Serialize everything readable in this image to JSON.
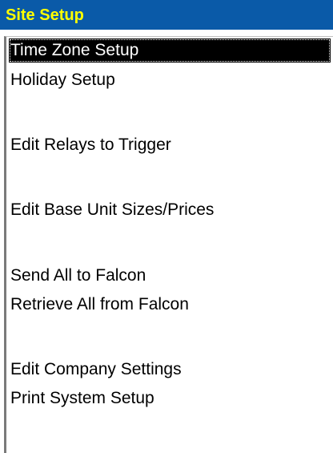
{
  "panel": {
    "title": "Site Setup",
    "colors": {
      "title_background": "#0a5aa8",
      "title_text": "#ffff00",
      "selection_background": "#000000",
      "selection_text": "#ffffff"
    },
    "items": [
      {
        "label": "Time Zone Setup",
        "selected": true
      },
      {
        "label": "Holiday Setup",
        "selected": false
      },
      {
        "label": "Edit Relays to Trigger",
        "selected": false
      },
      {
        "label": "Edit Base Unit Sizes/Prices",
        "selected": false
      },
      {
        "label": "Send All to Falcon",
        "selected": false
      },
      {
        "label": "Retrieve All from Falcon",
        "selected": false
      },
      {
        "label": "Edit Company Settings",
        "selected": false
      },
      {
        "label": "Print System Setup",
        "selected": false
      }
    ]
  }
}
